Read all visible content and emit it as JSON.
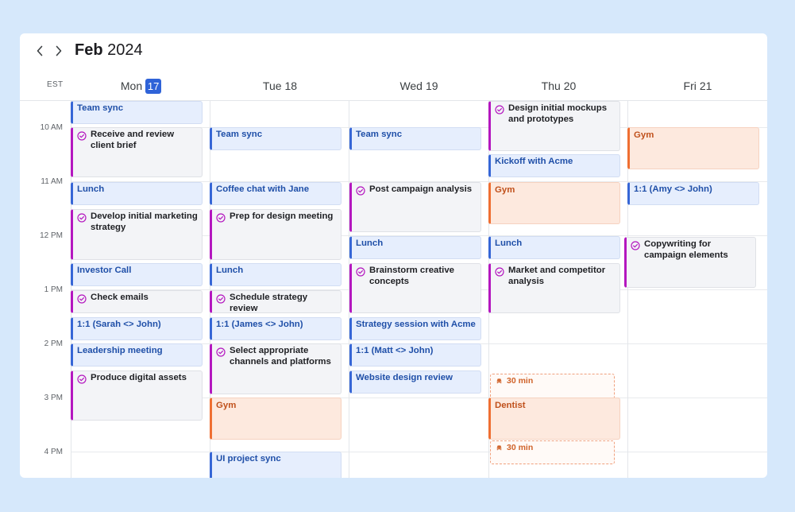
{
  "calendar": {
    "month": "Feb",
    "year": "2024",
    "timezone": "EST",
    "accent_colors": {
      "today": "#2f63d8",
      "meeting": "#3666d6",
      "task": "#b417bf",
      "personal": "#ef6f32"
    },
    "days": [
      {
        "name": "Mon",
        "date": "17",
        "today": true
      },
      {
        "name": "Tue",
        "date": "18"
      },
      {
        "name": "Wed",
        "date": "19"
      },
      {
        "name": "Thu",
        "date": "20"
      },
      {
        "name": "Fri",
        "date": "21"
      }
    ],
    "hours": [
      "10 AM",
      "11 AM",
      "12 PM",
      "1 PM",
      "2 PM",
      "3 PM",
      "4 PM"
    ],
    "events": {
      "mon": [
        {
          "title": "Team sync",
          "kind": "meeting"
        },
        {
          "title": "Receive and review client brief",
          "kind": "task"
        },
        {
          "title": "Lunch",
          "kind": "meeting"
        },
        {
          "title": "Develop initial marketing strategy",
          "kind": "task"
        },
        {
          "title": "Investor Call",
          "kind": "meeting"
        },
        {
          "title": "Check emails",
          "kind": "task"
        },
        {
          "title": "1:1 (Sarah <> John)",
          "kind": "meeting"
        },
        {
          "title": "Leadership meeting",
          "kind": "meeting"
        },
        {
          "title": "Produce digital assets",
          "kind": "task"
        }
      ],
      "tue": [
        {
          "title": "Team sync",
          "kind": "meeting"
        },
        {
          "title": "Coffee chat with Jane",
          "kind": "meeting"
        },
        {
          "title": "Prep for design meeting",
          "kind": "task"
        },
        {
          "title": "Lunch",
          "kind": "meeting"
        },
        {
          "title": "Schedule strategy review",
          "kind": "task"
        },
        {
          "title": "1:1 (James <> John)",
          "kind": "meeting"
        },
        {
          "title": "Select appropriate channels and platforms",
          "kind": "task"
        },
        {
          "title": "Gym",
          "kind": "personal"
        },
        {
          "title": "UI project sync",
          "kind": "meeting"
        }
      ],
      "wed": [
        {
          "title": "Team sync",
          "kind": "meeting"
        },
        {
          "title": "Post campaign analysis",
          "kind": "task"
        },
        {
          "title": "Lunch",
          "kind": "meeting"
        },
        {
          "title": "Brainstorm creative concepts",
          "kind": "task"
        },
        {
          "title": "Strategy session with Acme",
          "kind": "meeting"
        },
        {
          "title": "1:1 (Matt <> John)",
          "kind": "meeting"
        },
        {
          "title": "Website design review",
          "kind": "meeting"
        }
      ],
      "thu": [
        {
          "title": "Design initial mockups and prototypes",
          "kind": "task"
        },
        {
          "title": "Kickoff with Acme",
          "kind": "meeting"
        },
        {
          "title": "Gym",
          "kind": "personal"
        },
        {
          "title": "Lunch",
          "kind": "meeting"
        },
        {
          "title": "Market and competitor analysis",
          "kind": "task"
        },
        {
          "title": "30 min",
          "kind": "travel",
          "icon": "car-icon"
        },
        {
          "title": "Dentist",
          "kind": "personal"
        },
        {
          "title": "30 min",
          "kind": "travel",
          "icon": "car-icon"
        }
      ],
      "fri": [
        {
          "title": "Gym",
          "kind": "personal"
        },
        {
          "title": "1:1 (Amy <> John)",
          "kind": "meeting"
        },
        {
          "title": "Copywriting for campaign elements",
          "kind": "task"
        }
      ]
    }
  }
}
